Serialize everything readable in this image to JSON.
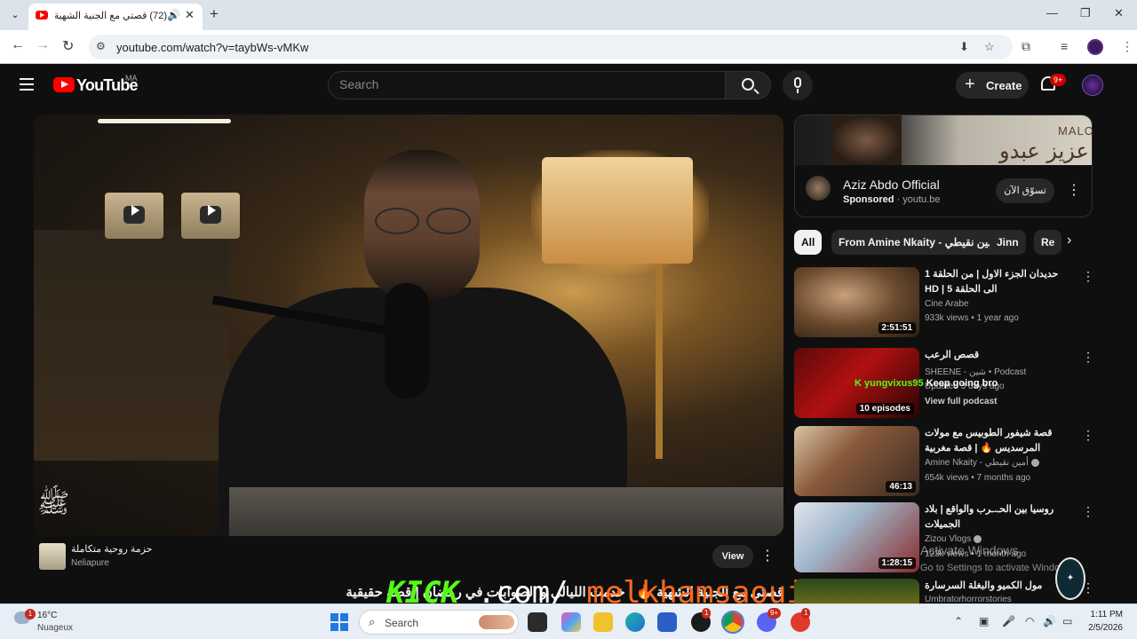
{
  "browser": {
    "tab_title": "(72) قصتي مع الجنية الشهية",
    "url": "youtube.com/watch?v=taybWs-vMKw",
    "new_tab_symbol": "+",
    "close_symbol": "✕"
  },
  "youtube": {
    "wordmark": "YouTube",
    "country": "MA",
    "search_placeholder": "Search",
    "create_label": "Create",
    "notification_count": "9+"
  },
  "video": {
    "title": "قصتي مع الجنية الشهية 🔥 | خدمت الليالي و الصوابات في رمضان | قصة حقيقية",
    "watermark": "ﷺ",
    "ad": {
      "title": "حزمة روحية متكاملة",
      "channel": "Neliapure",
      "view_label": "View"
    }
  },
  "overlay": {
    "kick": "KICK",
    "dot_com": ".com/",
    "handle": "melkhamsaoui"
  },
  "sidebar": {
    "sponsored_ad": {
      "banner_text": "عزيز عبدو",
      "banner_brand": "MALO",
      "name": "Aziz Abdo Official",
      "sponsored": "Sponsored",
      "domain": "youtu.be",
      "shop_label": "تسوّق الآن"
    },
    "chips": [
      "All",
      "From Amine Nkaity - أمين نقيطي",
      "Jinn",
      "Re"
    ],
    "recommendations": [
      {
        "title": "حديدان الجزء الاول | من الحلقة 1 الى الحلقة 5 | HD",
        "channel": "Cine Arabe",
        "meta": "933k views • 1 year ago",
        "duration": "2:51:51"
      },
      {
        "title": "قصص الرعب",
        "channel": "SHEENE - شين • Podcast",
        "meta": "Updated 3 days ago",
        "extra": "View full podcast",
        "duration": "10 episodes"
      },
      {
        "title": "قصة شيفور الطوبيس مع مولات المرسديس 🔥 | قصة مغربية رائعةMA",
        "channel": "Amine Nkaity - أمين نقيطي",
        "meta": "654k views • 7 months ago",
        "duration": "46:13"
      },
      {
        "title": "روسيا بين الحـ.ـرب والواقع | بلاد الجميلات",
        "channel": "Zizou Vlogs",
        "meta": "123k views • 1 month ago",
        "duration": "1:28:15"
      },
      {
        "title": "مول الكميو والبغلة السرسارة",
        "channel": "Umbratorhorrorstories",
        "meta": "",
        "duration": ""
      }
    ],
    "chat_overlay_user": "yungvixus95",
    "chat_overlay_msg": "Keep going bro",
    "activate_title": "Activate Windows",
    "activate_sub": "Go to Settings to activate Windows."
  },
  "taskbar": {
    "weather_temp": "16°C",
    "weather_desc": "Nuageux",
    "weather_badge": "1",
    "search_label": "Search",
    "time": "1:11 PM",
    "date": "2/5/2026",
    "badge_9plus": "9+",
    "badge_1": "1"
  }
}
